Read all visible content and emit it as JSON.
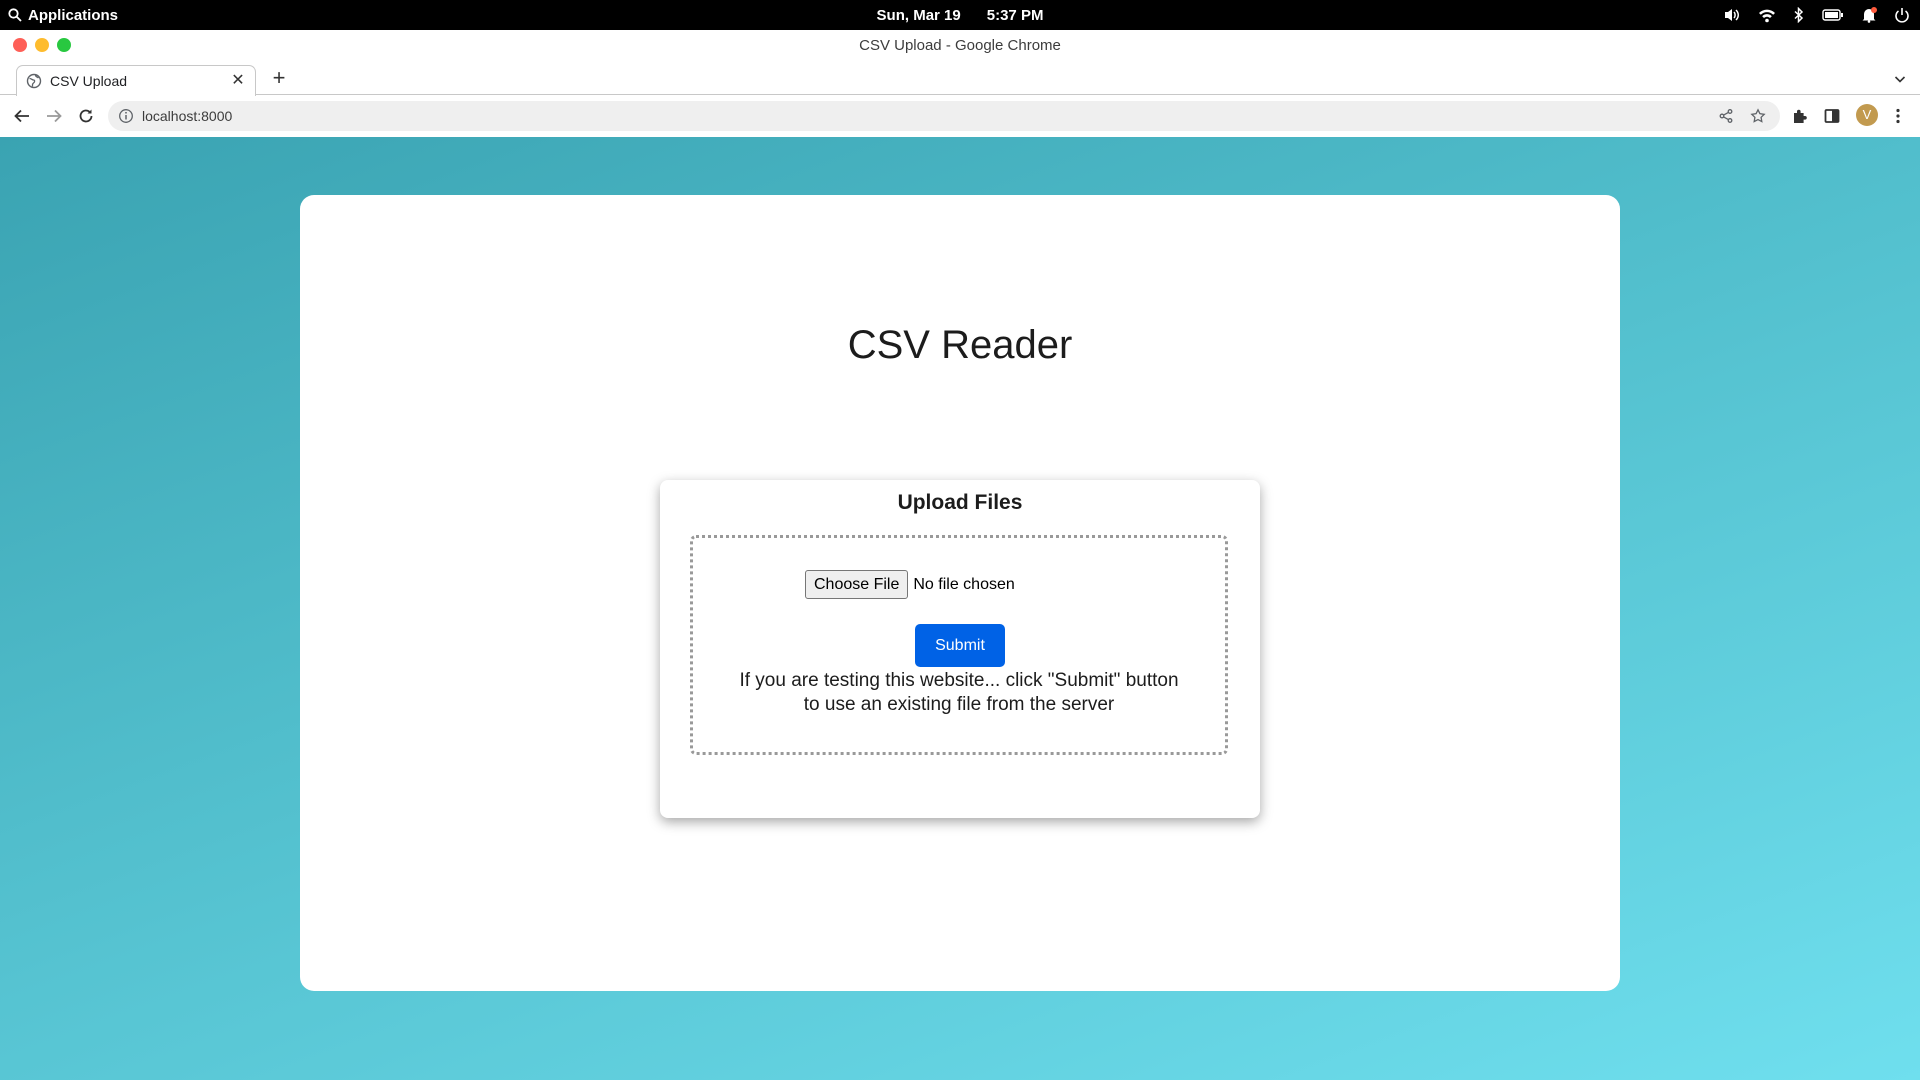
{
  "os_bar": {
    "menu_label": "Applications",
    "date": "Sun, Mar 19",
    "time": "5:37 PM",
    "status_icons": [
      "volume-icon",
      "wifi-icon",
      "bluetooth-icon",
      "battery-icon",
      "notification-bell-icon",
      "power-icon"
    ]
  },
  "browser": {
    "window_title": "CSV Upload - Google Chrome",
    "tab": {
      "label": "CSV Upload",
      "favicon": "globe-icon"
    },
    "address": "localhost:8000",
    "profile_initial": "V"
  },
  "page": {
    "title": "CSV Reader",
    "upload": {
      "heading": "Upload Files",
      "choose_file_label": "Choose File",
      "file_status": "No file chosen",
      "submit_label": "Submit",
      "hint_line1": "If you are testing this website... click \"Submit\" button",
      "hint_line2": "to use an existing file from the server"
    }
  },
  "colors": {
    "background_start": "#3aa3b2",
    "background_end": "#6fdfee",
    "submit_button": "#0062e6",
    "avatar": "#c29a4f"
  }
}
